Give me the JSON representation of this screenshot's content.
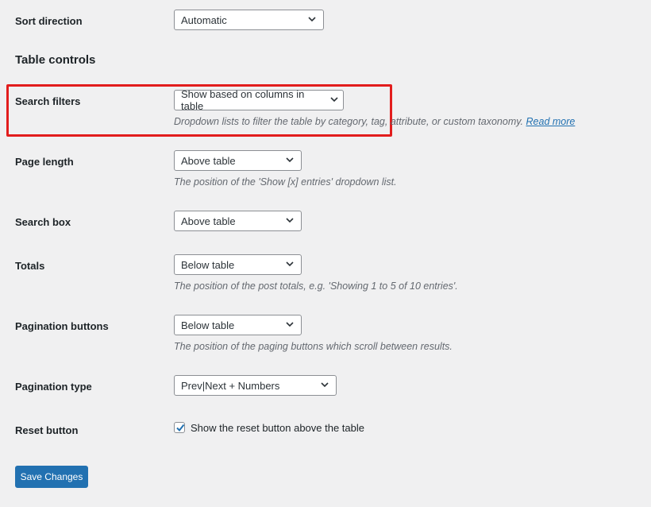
{
  "sort_direction": {
    "label": "Sort direction",
    "value": "Automatic"
  },
  "section_title": "Table controls",
  "search_filters": {
    "label": "Search filters",
    "value": "Show based on columns in table",
    "description": "Dropdown lists to filter the table by category, tag, attribute, or custom taxonomy.",
    "link_text": "Read more"
  },
  "page_length": {
    "label": "Page length",
    "value": "Above table",
    "description": "The position of the 'Show [x] entries' dropdown list."
  },
  "search_box": {
    "label": "Search box",
    "value": "Above table"
  },
  "totals": {
    "label": "Totals",
    "value": "Below table",
    "description": "The position of the post totals, e.g. 'Showing 1 to 5 of 10 entries'."
  },
  "pagination_buttons": {
    "label": "Pagination buttons",
    "value": "Below table",
    "description": "The position of the paging buttons which scroll between results."
  },
  "pagination_type": {
    "label": "Pagination type",
    "value": "Prev|Next + Numbers"
  },
  "reset_button": {
    "label": "Reset button",
    "checkbox_label": "Show the reset button above the table",
    "checked": true
  },
  "save_button": {
    "label": "Save Changes"
  },
  "colors": {
    "accent": "#2271b1",
    "highlight": "#e21d1d",
    "background": "#f0f0f1"
  },
  "icons": [
    "chevron-down-icon",
    "checkmark-icon"
  ]
}
